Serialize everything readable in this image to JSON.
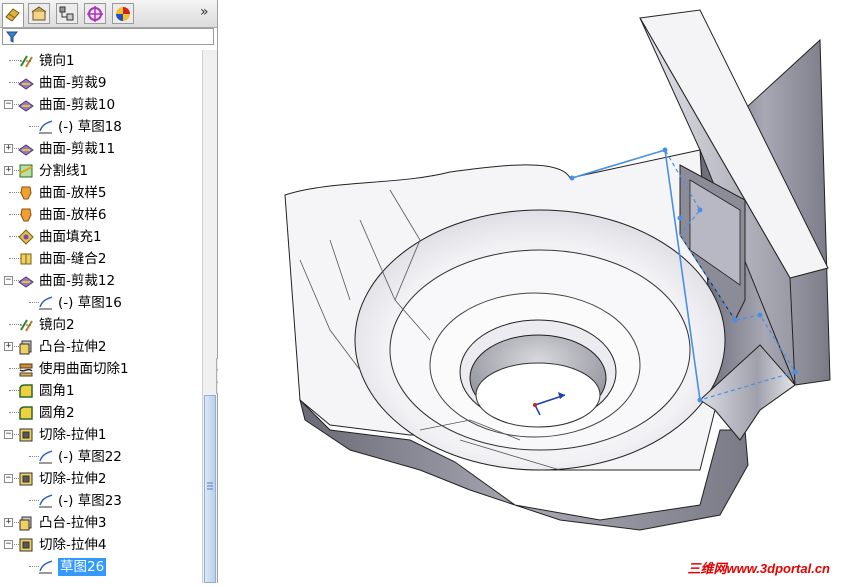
{
  "tree_items": [
    {
      "label": "镜向1",
      "icon": "mirror-icon",
      "indent": 0,
      "expander": "none"
    },
    {
      "label": "曲面-剪裁9",
      "icon": "surface-trim-icon",
      "indent": 0,
      "expander": "none"
    },
    {
      "label": "曲面-剪裁10",
      "icon": "surface-trim-icon",
      "indent": 0,
      "expander": "minus"
    },
    {
      "label": "(-) 草图18",
      "icon": "sketch-icon",
      "indent": 1,
      "expander": "none"
    },
    {
      "label": "曲面-剪裁11",
      "icon": "surface-trim-icon",
      "indent": 0,
      "expander": "plus"
    },
    {
      "label": "分割线1",
      "icon": "split-line-icon",
      "indent": 0,
      "expander": "plus"
    },
    {
      "label": "曲面-放样5",
      "icon": "surface-loft-icon",
      "indent": 0,
      "expander": "none"
    },
    {
      "label": "曲面-放样6",
      "icon": "surface-loft-icon",
      "indent": 0,
      "expander": "none"
    },
    {
      "label": "曲面填充1",
      "icon": "surface-fill-icon",
      "indent": 0,
      "expander": "none"
    },
    {
      "label": "曲面-缝合2",
      "icon": "surface-knit-icon",
      "indent": 0,
      "expander": "none"
    },
    {
      "label": "曲面-剪裁12",
      "icon": "surface-trim-icon",
      "indent": 0,
      "expander": "minus"
    },
    {
      "label": "(-) 草图16",
      "icon": "sketch-icon",
      "indent": 1,
      "expander": "none"
    },
    {
      "label": "镜向2",
      "icon": "mirror-icon",
      "indent": 0,
      "expander": "none"
    },
    {
      "label": "凸台-拉伸2",
      "icon": "boss-extrude-icon",
      "indent": 0,
      "expander": "plus"
    },
    {
      "label": "使用曲面切除1",
      "icon": "surface-cut-icon",
      "indent": 0,
      "expander": "none"
    },
    {
      "label": "圆角1",
      "icon": "fillet-icon",
      "indent": 0,
      "expander": "none"
    },
    {
      "label": "圆角2",
      "icon": "fillet-icon",
      "indent": 0,
      "expander": "none"
    },
    {
      "label": "切除-拉伸1",
      "icon": "cut-extrude-icon",
      "indent": 0,
      "expander": "minus"
    },
    {
      "label": "(-) 草图22",
      "icon": "sketch-icon",
      "indent": 1,
      "expander": "none"
    },
    {
      "label": "切除-拉伸2",
      "icon": "cut-extrude-icon",
      "indent": 0,
      "expander": "minus"
    },
    {
      "label": "(-) 草图23",
      "icon": "sketch-icon",
      "indent": 1,
      "expander": "none"
    },
    {
      "label": "凸台-拉伸3",
      "icon": "boss-extrude-icon",
      "indent": 0,
      "expander": "plus"
    },
    {
      "label": "切除-拉伸4",
      "icon": "cut-extrude-icon",
      "indent": 0,
      "expander": "minus"
    },
    {
      "label": "草图26",
      "icon": "sketch-icon",
      "indent": 1,
      "expander": "none",
      "selected": true
    }
  ],
  "tabs": [
    {
      "icon": "feature-manager-icon",
      "active": true
    },
    {
      "icon": "property-manager-icon",
      "active": false
    },
    {
      "icon": "configuration-manager-icon",
      "active": false
    },
    {
      "icon": "dimxpert-icon",
      "active": false
    },
    {
      "icon": "display-manager-icon",
      "active": false
    }
  ],
  "tab_more": "»",
  "watermark": {
    "brand": "三维网",
    "url": "www.3dportal.cn"
  },
  "colors": {
    "selection": "#3399ff",
    "watermark": "#e60000",
    "sketch_line": "#4a90e2"
  }
}
